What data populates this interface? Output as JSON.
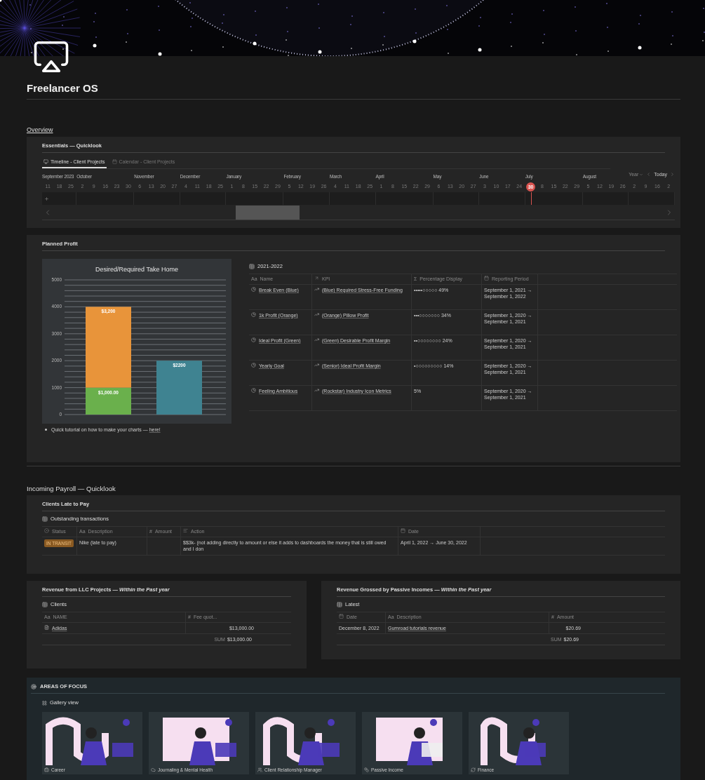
{
  "page": {
    "title": "Freelancer OS",
    "overview_link": "Overview"
  },
  "essentials": {
    "title": "Essentials — Quicklook",
    "tabs": [
      {
        "label": "Timeline - Client Projects",
        "selected": true
      },
      {
        "label": "Calendar - Client Projects",
        "selected": false
      }
    ],
    "timeline": {
      "view": "Year",
      "today_button": "Today",
      "months": [
        {
          "label": "September 2023",
          "days": [
            "11",
            "18",
            "25"
          ]
        },
        {
          "label": "October",
          "days": [
            "2",
            "9",
            "16",
            "23",
            "30"
          ]
        },
        {
          "label": "November",
          "days": [
            "6",
            "13",
            "20",
            "27"
          ]
        },
        {
          "label": "December",
          "days": [
            "4",
            "11",
            "18",
            "25"
          ]
        },
        {
          "label": "January",
          "days": [
            "1",
            "8",
            "15",
            "22",
            "29"
          ]
        },
        {
          "label": "February",
          "days": [
            "5",
            "12",
            "19",
            "26"
          ]
        },
        {
          "label": "March",
          "days": [
            "4",
            "11",
            "18",
            "25"
          ]
        },
        {
          "label": "April",
          "days": [
            "1",
            "8",
            "15",
            "22",
            "29"
          ]
        },
        {
          "label": "May",
          "days": [
            "6",
            "13",
            "20",
            "27"
          ]
        },
        {
          "label": "June",
          "days": [
            "3",
            "10",
            "17",
            "24"
          ]
        },
        {
          "label": "July",
          "today": "30",
          "days": [
            "8",
            "15",
            "22",
            "29"
          ]
        },
        {
          "label": "August",
          "days": [
            "5",
            "12",
            "19",
            "26"
          ]
        },
        {
          "days": [
            "2",
            "9",
            "16",
            "2"
          ]
        }
      ]
    }
  },
  "planned_profit": {
    "title": "Planned Profit",
    "chart_data": {
      "type": "bar",
      "title": "Desired/Required Take Home",
      "stacked": true,
      "grid": true,
      "ylim": [
        0,
        5000
      ],
      "yticks": [
        0,
        1000,
        2000,
        3000,
        4000,
        5000
      ],
      "series": [
        {
          "color": "#6ab04c",
          "values": [
            1000,
            null
          ]
        },
        {
          "color": "#e8943a",
          "values": [
            3000,
            null
          ]
        },
        {
          "color": "#3f8391",
          "values": [
            null,
            2000
          ]
        }
      ],
      "value_labels": [
        [
          "$1,000.00",
          null
        ],
        [
          "$3,200",
          null
        ],
        [
          null,
          "$2200"
        ]
      ]
    },
    "note": {
      "text": "Quick tutorial on how to make your charts — ",
      "link": "here!"
    },
    "table": {
      "title": "2021-2022",
      "columns": [
        {
          "kind": "title",
          "glyph": "Aa",
          "label": "Name"
        },
        {
          "kind": "relation",
          "label": "KPI"
        },
        {
          "kind": "formula",
          "glyph": "Σ",
          "label": "Percentage Display"
        },
        {
          "kind": "date",
          "label": "Reporting Period"
        }
      ],
      "rows": [
        {
          "cells": [
            "Break Even (Blue)",
            "(Blue) Required Stress-Free Funding",
            "•••••○○○○○ 49%",
            "September 1, 2021 → September 1, 2022"
          ]
        },
        {
          "cells": [
            "1k Profit (Orange)",
            "(Orange) Pillow Profit",
            "•••○○○○○○○ 34%",
            "September 1, 2020 → September 1, 2021"
          ]
        },
        {
          "cells": [
            "Ideal Profit (Green)",
            "(Green) Desirable Profit Margin",
            "••○○○○○○○○ 24%",
            "September 1, 2020 → September 1, 2021"
          ]
        },
        {
          "cells": [
            "Yearly Goal",
            "(Senior) Ideal Profit Margin",
            "•○○○○○○○○○ 14%",
            "September 1, 2020 → September 1, 2021"
          ]
        },
        {
          "cells": [
            "Feeling Ambitious",
            "(Rockstar) Industry Icon Metrics",
            "5%",
            "September 1, 2020 → September 1, 2021"
          ]
        }
      ]
    }
  },
  "payroll": {
    "heading": "Incoming Payroll — Quicklook",
    "title": "Clients Late to Pay",
    "table": {
      "title": "Outstanding transactions",
      "columns": [
        {
          "kind": "status",
          "label": "Status"
        },
        {
          "kind": "title",
          "glyph": "Aa",
          "label": "Description"
        },
        {
          "kind": "number",
          "glyph": "#",
          "label": "Amount"
        },
        {
          "kind": "action",
          "label": "Action"
        },
        {
          "kind": "date",
          "label": "Date"
        }
      ],
      "rows": [
        {
          "cells": [
            "IN TRANSIT",
            "Nike (late to pay)",
            null,
            "$$3k- (not adding directly to amount or else it adds to dashboards the money that is still owed and I don",
            "April 1, 2022 → June 30, 2022"
          ]
        }
      ]
    }
  },
  "revenue": [
    {
      "title": "Revenue from LLC Projects — *Within the Past year*",
      "table": {
        "title": "Clients",
        "columns": [
          {
            "kind": "title",
            "glyph": "Aa",
            "label": "NAME"
          },
          {
            "kind": "number",
            "glyph": "#",
            "label": "Fee quot..."
          }
        ],
        "rows": [
          {
            "cells": [
              "Adidas",
              "$13,000.00"
            ]
          }
        ],
        "sum": {
          "label": "SUM",
          "value": "$13,000.00"
        }
      }
    },
    {
      "title": "Revenue Grossed by Passive Incomes — *Within the Past year*",
      "table": {
        "title": "Latest",
        "columns": [
          {
            "kind": "date",
            "label": "Date"
          },
          {
            "kind": "title",
            "glyph": "Aa",
            "label": "Description"
          },
          {
            "kind": "number",
            "glyph": "#",
            "label": "Amount"
          }
        ],
        "rows": [
          {
            "cells": [
              "December 8, 2022",
              "Gumroad tutorials revenue",
              "$20.69"
            ]
          }
        ],
        "sum": {
          "label": "SUM",
          "value": "$20.69"
        }
      }
    }
  ],
  "areas": {
    "title": "AREAS OF FOCUS",
    "view": "Gallery view",
    "cards": [
      {
        "label": "Career"
      },
      {
        "label": "Journaling & Mental Health"
      },
      {
        "label": "Client Relationship Manager"
      },
      {
        "label": "Passive Income"
      },
      {
        "label": "Finance"
      }
    ]
  }
}
